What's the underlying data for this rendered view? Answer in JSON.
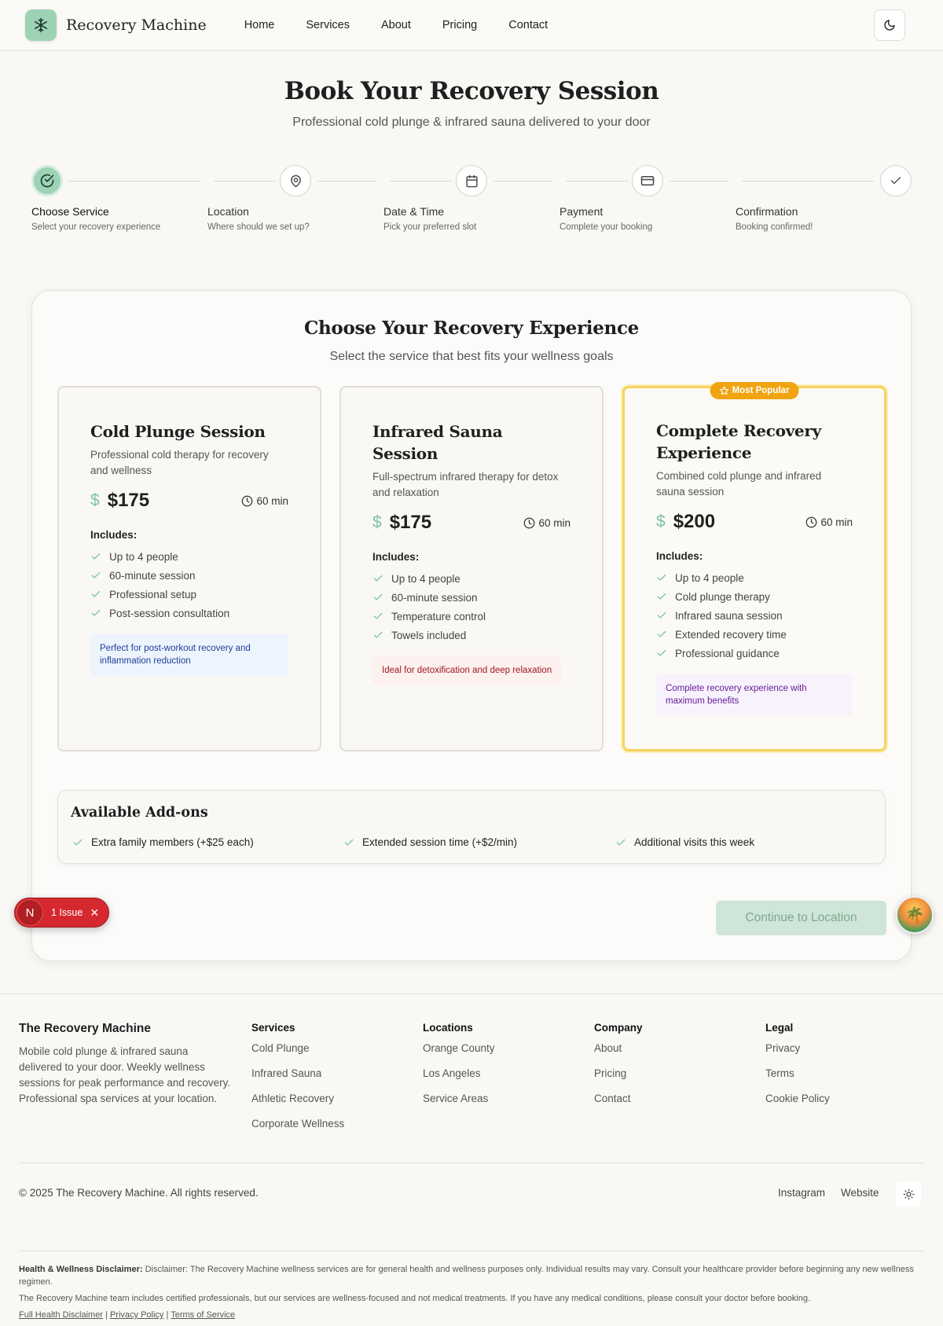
{
  "header": {
    "logo_text": "Recovery Machine",
    "nav": [
      "Home",
      "Services",
      "About",
      "Pricing",
      "Contact"
    ]
  },
  "hero": {
    "title": "Book Your Recovery Session",
    "subtitle": "Professional cold plunge & infrared sauna delivered to your door"
  },
  "steps": [
    {
      "title": "Choose Service",
      "desc": "Select your recovery experience",
      "icon": "check-circle-icon",
      "state": "active"
    },
    {
      "title": "Location",
      "desc": "Where should we set up?",
      "icon": "map-pin-icon",
      "state": "pending"
    },
    {
      "title": "Date & Time",
      "desc": "Pick your preferred slot",
      "icon": "calendar-icon",
      "state": "pending"
    },
    {
      "title": "Payment",
      "desc": "Complete your booking",
      "icon": "credit-card-icon",
      "state": "pending"
    },
    {
      "title": "Confirmation",
      "desc": "Booking confirmed!",
      "icon": "check-icon",
      "state": "pending"
    }
  ],
  "selection": {
    "title": "Choose Your Recovery Experience",
    "subtitle": "Select the service that best fits your wellness goals",
    "includes_label": "Includes:",
    "services": [
      {
        "name": "Cold Plunge Session",
        "desc": "Professional cold therapy for recovery and wellness",
        "price": "$175",
        "duration": "60 min",
        "features": [
          "Up to 4 people",
          "60-minute session",
          "Professional setup",
          "Post-session consultation"
        ],
        "note": "Perfect for post-workout recovery and inflammation reduction"
      },
      {
        "name": "Infrared Sauna Session",
        "desc": "Full-spectrum infrared therapy for detox and relaxation",
        "price": "$175",
        "duration": "60 min",
        "features": [
          "Up to 4 people",
          "60-minute session",
          "Temperature control",
          "Towels included"
        ],
        "note": "Ideal for detoxification and deep relaxation"
      },
      {
        "name": "Complete Recovery Experience",
        "desc": "Combined cold plunge and infrared sauna session",
        "price": "$200",
        "duration": "60 min",
        "badge": "Most Popular",
        "features": [
          "Up to 4 people",
          "Cold plunge therapy",
          "Infrared sauna session",
          "Extended recovery time",
          "Professional guidance"
        ],
        "note": "Complete recovery experience with maximum benefits"
      }
    ]
  },
  "addons": {
    "title": "Available Add-ons",
    "items": [
      "Extra family members (+$25 each)",
      "Extended session time (+$2/min)",
      "Additional visits this week"
    ]
  },
  "continue_label": "Continue to Location",
  "issue_badge": {
    "letter": "N",
    "text": "1 Issue"
  },
  "footer": {
    "brand": "The Recovery Machine",
    "brand_desc": "Mobile cold plunge & infrared sauna delivered to your door. Weekly wellness sessions for peak performance and recovery. Professional spa services at your location.",
    "columns": [
      {
        "title": "Services",
        "links": [
          "Cold Plunge",
          "Infrared Sauna",
          "Athletic Recovery",
          "Corporate Wellness"
        ]
      },
      {
        "title": "Locations",
        "links": [
          "Orange County",
          "Los Angeles",
          "Service Areas"
        ]
      },
      {
        "title": "Company",
        "links": [
          "About",
          "Pricing",
          "Contact"
        ]
      },
      {
        "title": "Legal",
        "links": [
          "Privacy",
          "Terms",
          "Cookie Policy"
        ]
      }
    ],
    "copyright": "© 2025 The Recovery Machine. All rights reserved.",
    "social": [
      "Instagram",
      "Website"
    ],
    "disclaimer_label": "Health & Wellness Disclaimer:",
    "disclaimer_text": "Disclaimer: The Recovery Machine wellness services are for general health and wellness purposes only. Individual results may vary. Consult your healthcare provider before beginning any new wellness regimen.",
    "disclaimer_text2": "The Recovery Machine team includes certified professionals, but our services are wellness-focused and not medical treatments. If you have any medical conditions, please consult your doctor before booking.",
    "legal_links": [
      "Full Health Disclaimer",
      "Privacy Policy",
      "Terms of Service"
    ]
  },
  "colors": {
    "accent": "#9ed2b5",
    "badge": "#f0a412",
    "featured_border": "#f7d25e",
    "issue": "#d5292f"
  }
}
